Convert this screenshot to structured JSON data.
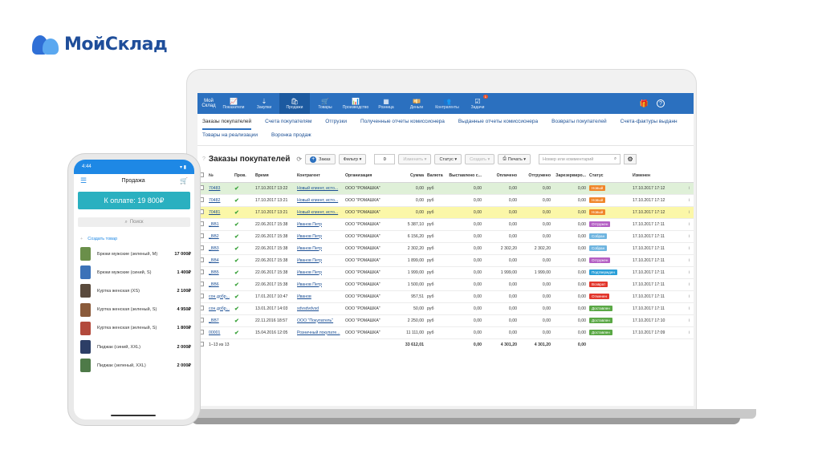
{
  "logo": {
    "text": "МойСклад"
  },
  "app": {
    "brand": "Мой Склад",
    "nav": [
      {
        "label": "Показатели",
        "icon": "📈"
      },
      {
        "label": "Закупки",
        "icon": "⇣"
      },
      {
        "label": "Продажи",
        "icon": "🛍"
      },
      {
        "label": "Товары",
        "icon": "🛒"
      },
      {
        "label": "Производство",
        "icon": "📊"
      },
      {
        "label": "Розница",
        "icon": "▦"
      },
      {
        "label": "Деньги",
        "icon": "💴"
      },
      {
        "label": "Контрагенты",
        "icon": "👥"
      },
      {
        "label": "Задачи",
        "icon": "☑",
        "badge": "1"
      }
    ],
    "top_right": {
      "gift": "🎁",
      "help": "?"
    },
    "subtabs_row1": [
      "Заказы покупателей",
      "Счета покупателям",
      "Отгрузки",
      "Полученные отчеты комиссионера",
      "Выданные отчеты комиссионера",
      "Возвраты покупателей",
      "Счета-фактуры выданн"
    ],
    "subtabs_row2": [
      "Товары на реализации",
      "Воронка продаж"
    ],
    "toolbar": {
      "title": "Заказы покупателей",
      "add_label": "Заказ",
      "filter_label": "Фильтр ▾",
      "count_value": "0",
      "change_label": "Изменить ▾",
      "status_label": "Статус ▾",
      "create_label": "Создать ▾",
      "print_label": "Печать ▾",
      "search_placeholder": "Номер или комментарий"
    },
    "table": {
      "headers": [
        "",
        "№",
        "Пров.",
        "Время",
        "Контрагент",
        "Организация",
        "Сумма",
        "Валюта",
        "Выставлено с...",
        "Оплачено",
        "Отгружено",
        "Зарезервиро...",
        "Статус",
        "Изменен",
        ""
      ],
      "rows": [
        {
          "hl": "green",
          "num": "70483",
          "time": "17.10.2017 13:22",
          "agent": "Новый клиент, исто...",
          "org": "ООО \"РОМАШКА\"",
          "sum": "0,00",
          "cur": "руб",
          "inv": "0,00",
          "paid": "0,00",
          "ship": "0,00",
          "res": "0,00",
          "status": "Новый",
          "color": "#f0862a",
          "mod": "17.10.2017 17:12"
        },
        {
          "hl": "",
          "num": "70482",
          "time": "17.10.2017 13:21",
          "agent": "Новый клиент, исто...",
          "org": "ООО \"РОМАШКА\"",
          "sum": "0,00",
          "cur": "руб",
          "inv": "0,00",
          "paid": "0,00",
          "ship": "0,00",
          "res": "0,00",
          "status": "Новый",
          "color": "#f0862a",
          "mod": "17.10.2017 17:12"
        },
        {
          "hl": "yellow",
          "num": "70481",
          "time": "17.10.2017 13:21",
          "agent": "Новый клиент, исто...",
          "org": "ООО \"РОМАШКА\"",
          "sum": "0,00",
          "cur": "руб",
          "inv": "0,00",
          "paid": "0,00",
          "ship": "0,00",
          "res": "0,00",
          "status": "Новый",
          "color": "#f0862a",
          "mod": "17.10.2017 17:12"
        },
        {
          "hl": "",
          "num": "_BB1",
          "time": "22.06.2017 15:38",
          "agent": "Иванов Петр",
          "org": "ООО \"РОМАШКА\"",
          "sum": "5 387,10",
          "cur": "руб",
          "inv": "0,00",
          "paid": "0,00",
          "ship": "0,00",
          "res": "0,00",
          "status": "Отгружен",
          "color": "#b45fc4",
          "mod": "17.10.2017 17:11"
        },
        {
          "hl": "",
          "num": "_BB2",
          "time": "22.06.2017 15:38",
          "agent": "Иванов Петр",
          "org": "ООО \"РОМАШКА\"",
          "sum": "6 156,20",
          "cur": "руб",
          "inv": "0,00",
          "paid": "0,00",
          "ship": "0,00",
          "res": "0,00",
          "status": "Собран",
          "color": "#6fb5e0",
          "mod": "17.10.2017 17:11"
        },
        {
          "hl": "",
          "num": "_BB3",
          "time": "22.06.2017 15:38",
          "agent": "Иванов Петр",
          "org": "ООО \"РОМАШКА\"",
          "sum": "2 302,20",
          "cur": "руб",
          "inv": "0,00",
          "paid": "2 302,20",
          "ship": "2 302,20",
          "res": "0,00",
          "status": "Собран",
          "color": "#6fb5e0",
          "mod": "17.10.2017 17:11"
        },
        {
          "hl": "",
          "num": "_BB4",
          "time": "22.06.2017 15:38",
          "agent": "Иванов Петр",
          "org": "ООО \"РОМАШКА\"",
          "sum": "1 899,00",
          "cur": "руб",
          "inv": "0,00",
          "paid": "0,00",
          "ship": "0,00",
          "res": "0,00",
          "status": "Отгружен",
          "color": "#b45fc4",
          "mod": "17.10.2017 17:11"
        },
        {
          "hl": "",
          "num": "_BB5",
          "time": "22.06.2017 15:38",
          "agent": "Иванов Петр",
          "org": "ООО \"РОМАШКА\"",
          "sum": "1 999,00",
          "cur": "руб",
          "inv": "0,00",
          "paid": "1 999,00",
          "ship": "1 999,00",
          "res": "0,00",
          "status": "Подтвержден",
          "color": "#2a9fd8",
          "mod": "17.10.2017 17:11"
        },
        {
          "hl": "",
          "num": "_BB6",
          "time": "22.06.2017 15:38",
          "agent": "Иванов Петр",
          "org": "ООО \"РОМАШКА\"",
          "sum": "1 500,00",
          "cur": "руб",
          "inv": "0,00",
          "paid": "0,00",
          "ship": "0,00",
          "res": "0,00",
          "status": "Возврат",
          "color": "#e2362c",
          "mod": "17.10.2017 17:11"
        },
        {
          "hl": "",
          "num": "сон добр...",
          "time": "17.01.2017 10:47",
          "agent": "Иванов",
          "org": "ООО \"РОМАШКА\"",
          "sum": "957,51",
          "cur": "руб",
          "inv": "0,00",
          "paid": "0,00",
          "ship": "0,00",
          "res": "0,00",
          "status": "Отменен",
          "color": "#e2362c",
          "mod": "17.10.2017 17:11"
        },
        {
          "hl": "",
          "num": "сон добр...",
          "time": "13.01.2017 14:03",
          "agent": "sdvsdvdvsd",
          "org": "ООО \"РОМАШКА\"",
          "sum": "50,00",
          "cur": "руб",
          "inv": "0,00",
          "paid": "0,00",
          "ship": "0,00",
          "res": "0,00",
          "status": "Доставлен",
          "color": "#5aa845",
          "mod": "17.10.2017 17:11"
        },
        {
          "hl": "",
          "num": "_BB7",
          "time": "22.11.2016 18:57",
          "agent": "ООО \"Покупатель\"",
          "org": "ООО \"РОМАШКА\"",
          "sum": "2 250,00",
          "cur": "руб",
          "inv": "0,00",
          "paid": "0,00",
          "ship": "0,00",
          "res": "0,00",
          "status": "Доставлен",
          "color": "#5aa845",
          "mod": "17.10.2017 17:10"
        },
        {
          "hl": "",
          "num": "00001",
          "time": "15.04.2016 12:05",
          "agent": "Розничный покупате...",
          "org": "ООО \"РОМАШКА\"",
          "sum": "11 111,00",
          "cur": "руб",
          "inv": "0,00",
          "paid": "0,00",
          "ship": "0,00",
          "res": "0,00",
          "status": "Доставлен",
          "color": "#5aa845",
          "mod": "17.10.2017 17:09"
        }
      ],
      "totals": {
        "pages": "1–13 из 13",
        "sum": "33 612,01",
        "inv": "0,00",
        "paid": "4 301,20",
        "ship": "4 301,20",
        "res": "0,00"
      }
    }
  },
  "phone": {
    "time": "4:44",
    "signal": "▾ ▮",
    "title": "Продажа",
    "pay_button": "К оплате: 19 800₽",
    "search_placeholder": "Поиск",
    "add_item": "Создать товар",
    "products": [
      {
        "name": "Брюки мужские (зеленый, M)",
        "price": "17 000₽",
        "color": "#6a8f4a"
      },
      {
        "name": "Брюки мужские (синий, S)",
        "price": "1 400₽",
        "color": "#3c72b8"
      },
      {
        "name": "Куртка женская (XS)",
        "price": "2 100₽",
        "color": "#5a4a3c"
      },
      {
        "name": "Куртка женская (зеленый, S)",
        "price": "4 950₽",
        "color": "#8a5a3a"
      },
      {
        "name": "Куртка женская (зеленый, S)",
        "price": "1 800₽",
        "color": "#b34a3c"
      },
      {
        "name": "Пиджак (синий, XXL)",
        "price": "2 000₽",
        "color": "#2c3e66"
      },
      {
        "name": "Пиджак (зеленый, XXL)",
        "price": "2 000₽",
        "color": "#4e7a48"
      }
    ]
  }
}
